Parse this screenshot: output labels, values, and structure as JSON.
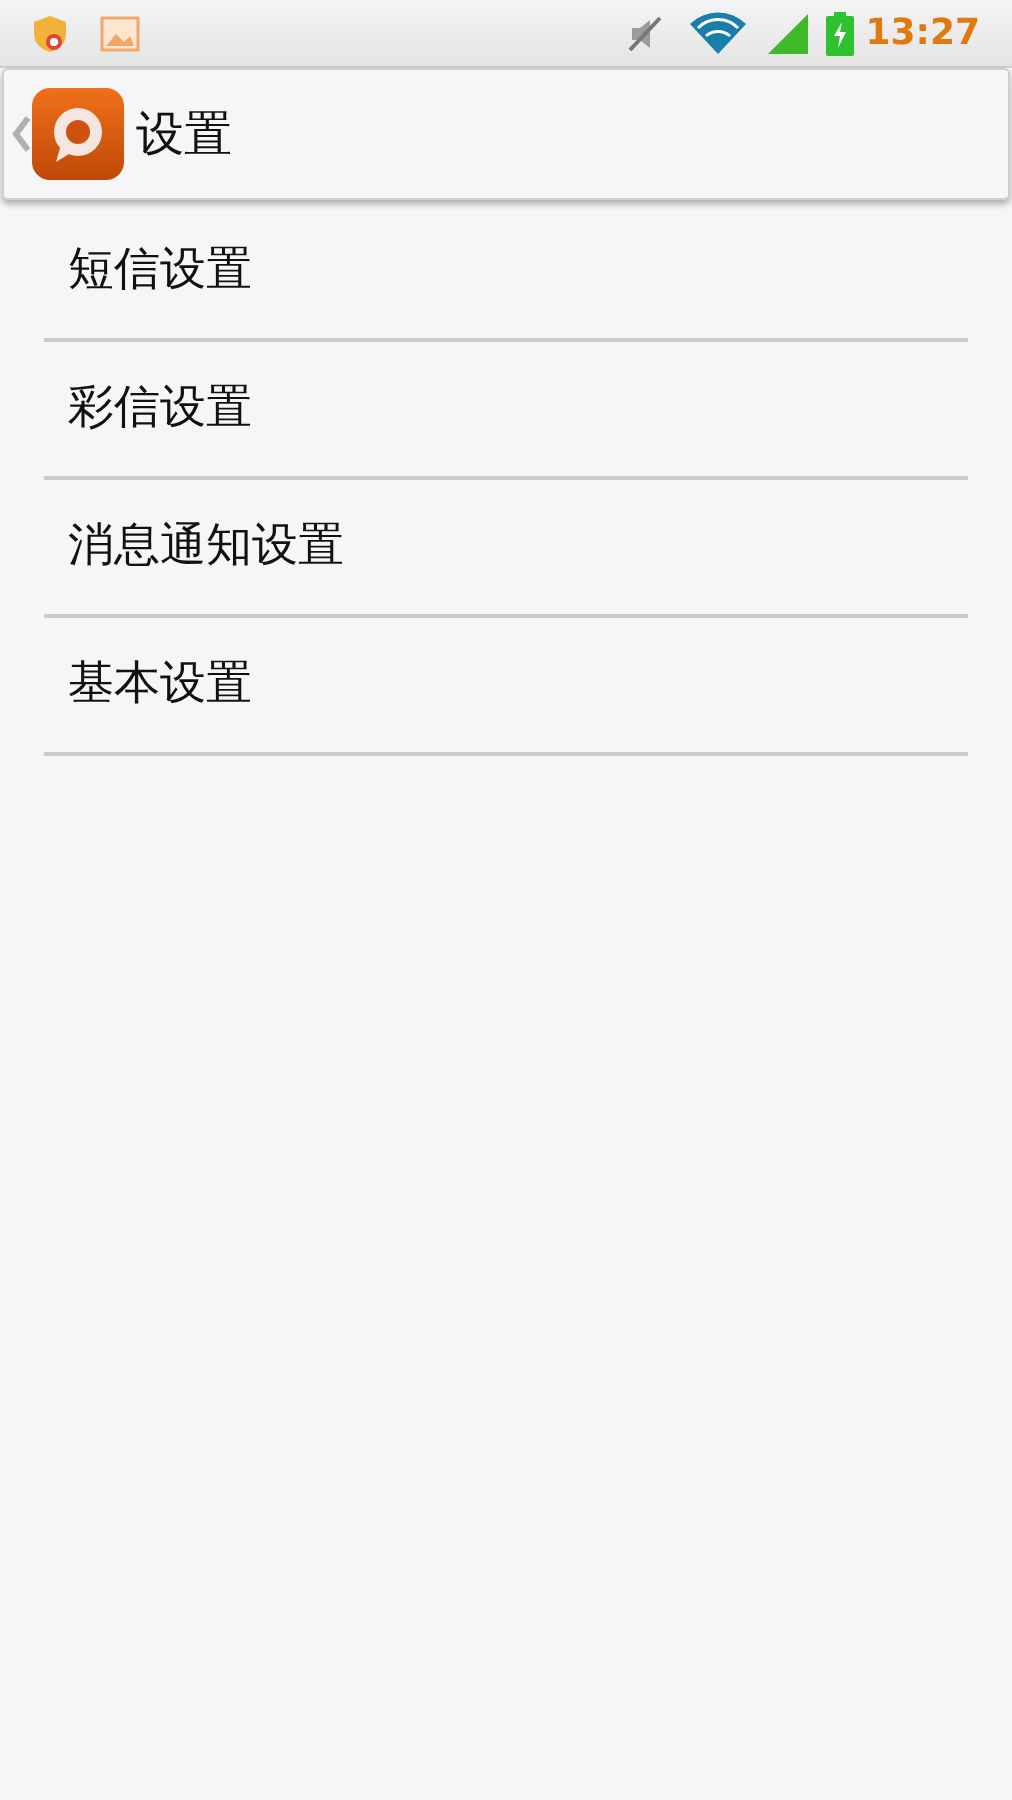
{
  "status_bar": {
    "time": "13:27"
  },
  "action_bar": {
    "title": "设置"
  },
  "settings": [
    {
      "label": "短信设置"
    },
    {
      "label": "彩信设置"
    },
    {
      "label": "消息通知设置"
    },
    {
      "label": "基本设置"
    }
  ]
}
